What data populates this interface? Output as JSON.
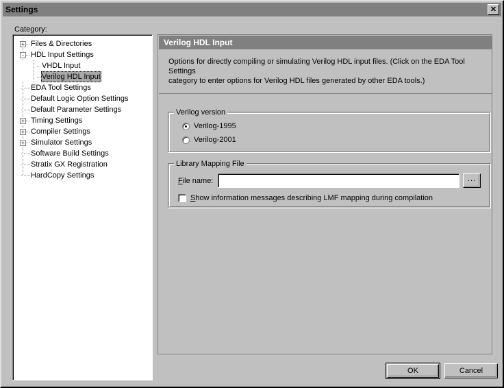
{
  "window": {
    "title": "Settings",
    "close_icon": "close-icon",
    "close_glyph": "✕"
  },
  "category": {
    "label": "Category:",
    "tree": [
      {
        "label": "Files & Directories",
        "depth": 0,
        "expander": "+",
        "selected": false
      },
      {
        "label": "HDL Input Settings",
        "depth": 0,
        "expander": "-",
        "selected": false
      },
      {
        "label": "VHDL Input",
        "depth": 1,
        "expander": "none",
        "selected": false
      },
      {
        "label": "Verilog HDL Input",
        "depth": 1,
        "expander": "none",
        "selected": true
      },
      {
        "label": "EDA Tool Settings",
        "depth": 0,
        "expander": "none",
        "selected": false
      },
      {
        "label": "Default Logic Option Settings",
        "depth": 0,
        "expander": "none",
        "selected": false
      },
      {
        "label": "Default Parameter Settings",
        "depth": 0,
        "expander": "none",
        "selected": false
      },
      {
        "label": "Timing Settings",
        "depth": 0,
        "expander": "+",
        "selected": false
      },
      {
        "label": "Compiler Settings",
        "depth": 0,
        "expander": "+",
        "selected": false
      },
      {
        "label": "Simulator Settings",
        "depth": 0,
        "expander": "+",
        "selected": false
      },
      {
        "label": "Software Build Settings",
        "depth": 0,
        "expander": "none",
        "selected": false
      },
      {
        "label": "Stratix GX Registration",
        "depth": 0,
        "expander": "none",
        "selected": false
      },
      {
        "label": "HardCopy Settings",
        "depth": 0,
        "expander": "none",
        "selected": false
      }
    ]
  },
  "panel": {
    "header": "Verilog HDL Input",
    "description_line1": "Options for directly compiling or simulating Verilog HDL input files.  (Click on the EDA Tool Settings",
    "description_line2": "category to enter options for Verilog HDL files generated by other EDA tools.)",
    "verilog_version": {
      "title": "Verilog version",
      "options": [
        {
          "label": "Verilog-1995",
          "selected": true
        },
        {
          "label": "Verilog-2001",
          "selected": false
        }
      ]
    },
    "library_mapping": {
      "title": "Library Mapping File",
      "file_name_label_prefix": "F",
      "file_name_label_rest": "ile name:",
      "file_name_value": "",
      "file_name_placeholder": "",
      "browse_label": "...",
      "checkbox": {
        "checked": false,
        "label_prefix": "S",
        "label_rest": "how information messages describing LMF mapping during compilation"
      }
    }
  },
  "buttons": {
    "ok": "OK",
    "cancel": "Cancel"
  },
  "colors": {
    "face": "#c0c0c0",
    "titlebar": "#808080",
    "header": "#808080",
    "selection": "#a8a8a8",
    "field": "#ffffff"
  }
}
